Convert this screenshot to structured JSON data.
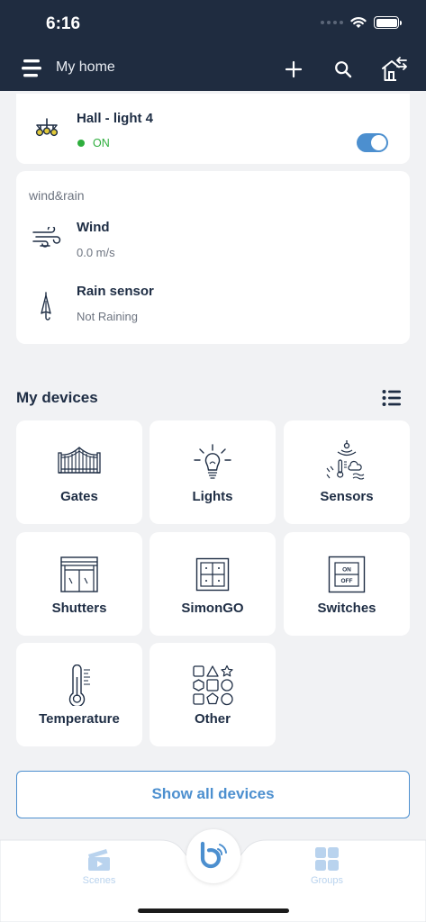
{
  "status_bar": {
    "time": "6:16"
  },
  "header": {
    "title": "My home"
  },
  "hall_light": {
    "name": "Hall - light 4",
    "state": "ON",
    "toggle_on": true
  },
  "wind_rain": {
    "title": "wind&rain",
    "wind": {
      "name": "Wind",
      "value": "0.0 m/s"
    },
    "rain": {
      "name": "Rain sensor",
      "value": "Not Raining"
    }
  },
  "devices": {
    "title": "My devices",
    "tiles": [
      {
        "label": "Gates",
        "icon": "gate-icon"
      },
      {
        "label": "Lights",
        "icon": "light-bulb-icon"
      },
      {
        "label": "Sensors",
        "icon": "sensors-icon"
      },
      {
        "label": "Shutters",
        "icon": "shutters-icon"
      },
      {
        "label": "SimonGO",
        "icon": "simongo-icon"
      },
      {
        "label": "Switches",
        "icon": "switches-icon"
      },
      {
        "label": "Temperature",
        "icon": "thermometer-icon"
      },
      {
        "label": "Other",
        "icon": "shapes-icon"
      }
    ],
    "switch_on": "ON",
    "switch_off": "OFF",
    "show_all": "Show all devices"
  },
  "bottom_nav": {
    "scenes": "Scenes",
    "groups": "Groups"
  },
  "colors": {
    "header_bg": "#1f2c40",
    "accent": "#4c8fcf",
    "on_green": "#2eae3d",
    "nav_inactive": "#b9d3ee"
  }
}
